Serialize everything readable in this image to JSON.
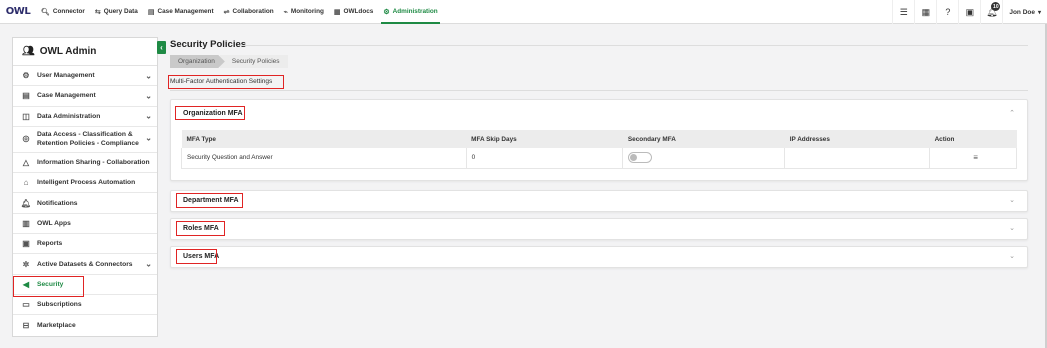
{
  "logo": {
    "text": "OWL"
  },
  "nav": [
    {
      "label": "Connector",
      "icon": "search-icon",
      "glyph": "🔍︎"
    },
    {
      "label": "Query Data",
      "icon": "query-icon",
      "glyph": "⇆"
    },
    {
      "label": "Case Management",
      "icon": "case-icon",
      "glyph": "▤"
    },
    {
      "label": "Collaboration",
      "icon": "collaboration-icon",
      "glyph": "⇌"
    },
    {
      "label": "Monitoring",
      "icon": "monitoring-icon",
      "glyph": "⌁"
    },
    {
      "label": "OWLdocs",
      "icon": "docs-icon",
      "glyph": "▦"
    },
    {
      "label": "Administration",
      "icon": "administration-icon",
      "glyph": "⚙"
    }
  ],
  "topbar": {
    "notification_count": "10",
    "user_name": "Jon Doe"
  },
  "sidebar": {
    "title": "OWL Admin",
    "items": [
      {
        "label": "User Management",
        "glyph": "⚙",
        "chevron": true
      },
      {
        "label": "Case Management",
        "glyph": "▤",
        "chevron": true
      },
      {
        "label": "Data Administration",
        "glyph": "◫",
        "chevron": true
      },
      {
        "label": "Data Access - Classification & Retention Policies - Compliance",
        "line1": "Data Access - Classification &",
        "line2": "Retention Policies - Compliance",
        "glyph": "◎",
        "chevron": true
      },
      {
        "label": "Information Sharing - Collaboration",
        "glyph": "△",
        "chevron": false
      },
      {
        "label": "Intelligent Process Automation",
        "glyph": "⌂",
        "chevron": false
      },
      {
        "label": "Notifications",
        "glyph": "🔔︎",
        "chevron": false
      },
      {
        "label": "OWL Apps",
        "glyph": "▥",
        "chevron": false
      },
      {
        "label": "Reports",
        "glyph": "▣",
        "chevron": false
      },
      {
        "label": "Active Datasets & Connectors",
        "glyph": "✲",
        "chevron": true
      },
      {
        "label": "Security",
        "glyph": "◀",
        "chevron": false
      },
      {
        "label": "Subscriptions",
        "glyph": "▭",
        "chevron": false
      },
      {
        "label": "Marketplace",
        "glyph": "⊟",
        "chevron": false
      }
    ]
  },
  "page": {
    "title": "Security Policies",
    "breadcrumb": [
      "Organization",
      "Security Policies"
    ],
    "section_label": "Multi-Factor Authentication Settings"
  },
  "panels": {
    "organization": "Organization MFA",
    "department": "Department MFA",
    "roles": "Roles MFA",
    "users": "Users MFA"
  },
  "mfa_table": {
    "columns": [
      "MFA Type",
      "MFA Skip Days",
      "Secondary MFA",
      "IP Addresses",
      "Action"
    ],
    "rows": [
      {
        "type": "Security Question and Answer",
        "skip_days": "0",
        "secondary_mfa": false,
        "ip_addresses": ""
      }
    ]
  },
  "colors": {
    "accent": "#1e8a44",
    "highlight": "#e02424"
  }
}
